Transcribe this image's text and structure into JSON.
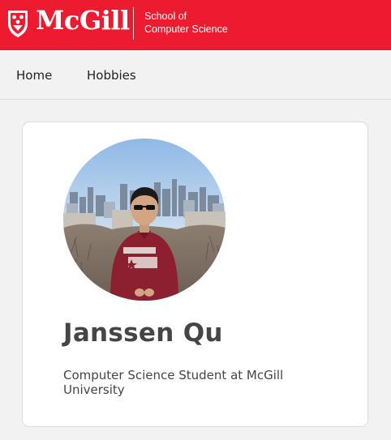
{
  "header": {
    "brand_name": "McGill",
    "school_line1": "School of",
    "school_line2": "Computer Science",
    "brand_color": "#ed1b2f",
    "logo_icon": "mcgill-crest-icon"
  },
  "nav": {
    "items": [
      {
        "label": "Home"
      },
      {
        "label": "Hobbies"
      }
    ]
  },
  "profile": {
    "name": "Janssen Qu",
    "tagline": "Computer Science Student at McGill University",
    "photo_description": "profile-photo"
  }
}
